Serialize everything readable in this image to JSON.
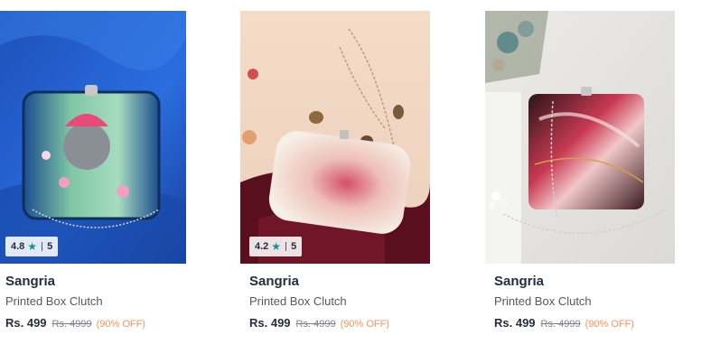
{
  "products": [
    {
      "brand": "Sangria",
      "name": "Printed Box Clutch",
      "price": "Rs. 499",
      "mrp": "Rs. 4999",
      "discount": "(90% OFF)",
      "rating": "4.8",
      "rating_count": "5",
      "image_icon": "blue-pichwai-box-clutch-image"
    },
    {
      "brand": "Sangria",
      "name": "Printed Box Clutch",
      "price": "Rs. 499",
      "mrp": "Rs. 4999",
      "discount": "(90% OFF)",
      "rating": "4.2",
      "rating_count": "5",
      "image_icon": "white-marble-box-clutch-image"
    },
    {
      "brand": "Sangria",
      "name": "Printed Box Clutch",
      "price": "Rs. 499",
      "mrp": "Rs. 4999",
      "discount": "(90% OFF)",
      "image_icon": "red-marble-box-clutch-image"
    }
  ],
  "colors": {
    "text_primary": "#282c3f",
    "text_secondary": "#535766",
    "mrp_gray": "#7e818c",
    "discount_orange": "#ff905a",
    "star_teal": "#14958f"
  },
  "icons": {
    "star": "★"
  }
}
